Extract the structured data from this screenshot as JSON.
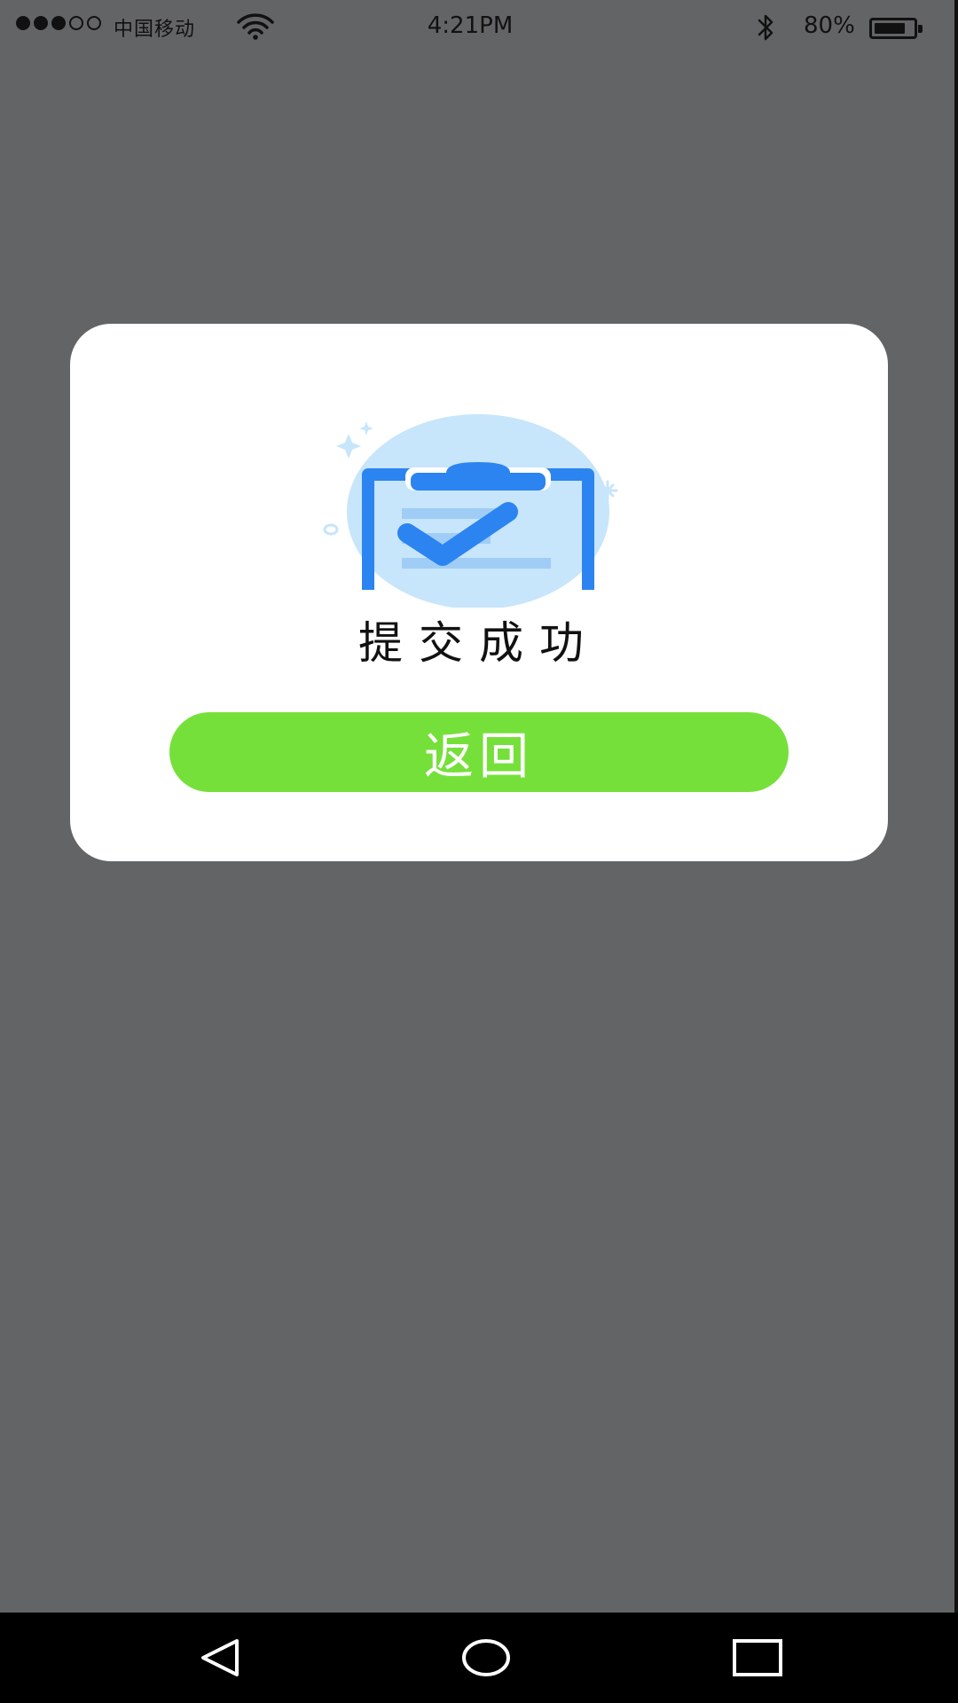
{
  "status_bar": {
    "signal_filled": 3,
    "signal_total": 5,
    "carrier": "中国移动",
    "time": "4:21PM",
    "battery_text": "80%",
    "battery_level": 0.8,
    "icons": [
      "signal-dots-icon",
      "wifi-icon",
      "bluetooth-icon",
      "battery-icon"
    ]
  },
  "dialog": {
    "illustration_icon": "clipboard-check-icon",
    "title": "提交成功",
    "back_button_label": "返回"
  },
  "colors": {
    "overlay": "#636466",
    "dialog_bg": "#ffffff",
    "button_green": "#76e03a",
    "icon_blue": "#2b84f0",
    "icon_light_blue": "#c7e5fb"
  },
  "nav_bar": {
    "icons": [
      "back-triangle-icon",
      "home-circle-icon",
      "recent-square-icon"
    ]
  }
}
